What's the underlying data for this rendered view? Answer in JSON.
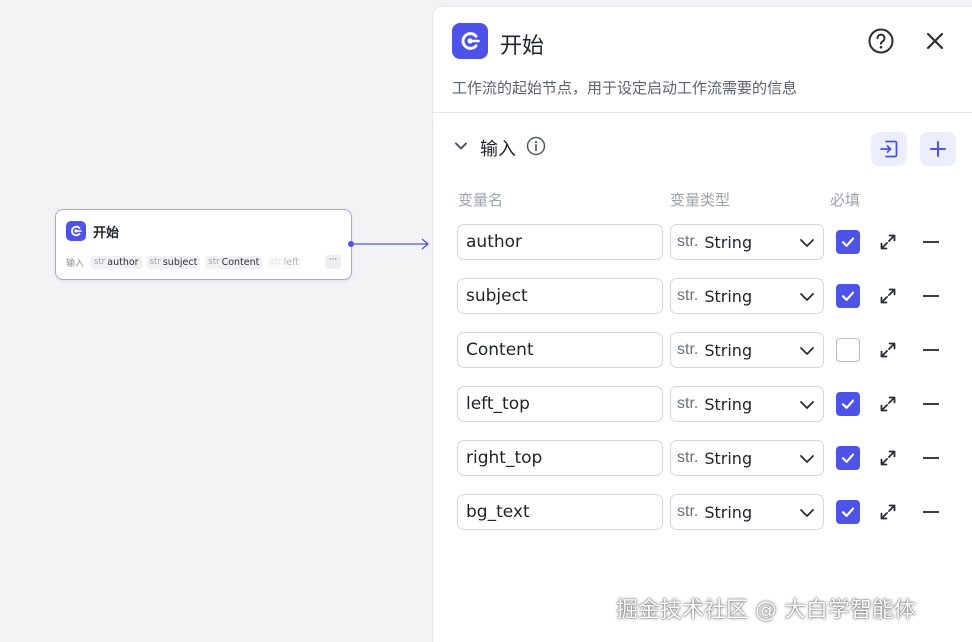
{
  "node": {
    "title": "开始",
    "footer_label": "输入",
    "chips": [
      {
        "type": "str",
        "name": "author"
      },
      {
        "type": "str",
        "name": "subject"
      },
      {
        "type": "str",
        "name": "Content"
      },
      {
        "type": "str",
        "name": "left"
      }
    ],
    "more": "···"
  },
  "panel": {
    "title": "开始",
    "description": "工作流的起始节点，用于设定启动工作流需要的信息",
    "section_title": "输入",
    "columns": {
      "name": "变量名",
      "type": "变量类型",
      "required": "必填"
    },
    "type_prefix": "str.",
    "variables": [
      {
        "name": "author",
        "type": "String",
        "required": true
      },
      {
        "name": "subject",
        "type": "String",
        "required": true
      },
      {
        "name": "Content",
        "type": "String",
        "required": false
      },
      {
        "name": "left_top",
        "type": "String",
        "required": true
      },
      {
        "name": "right_top",
        "type": "String",
        "required": true
      },
      {
        "name": "bg_text",
        "type": "String",
        "required": true
      }
    ]
  },
  "watermark": "掘金技术社区 @ 大白学智能体",
  "colors": {
    "accent": "#4d53e8",
    "canvas": "#f3f3f6",
    "node_border": "#a7a4f4"
  },
  "icons": [
    "start-icon",
    "help-icon",
    "close-icon",
    "chevron-down-icon",
    "info-icon",
    "import-icon",
    "plus-icon",
    "expand-icon",
    "minus-icon",
    "check-icon"
  ]
}
